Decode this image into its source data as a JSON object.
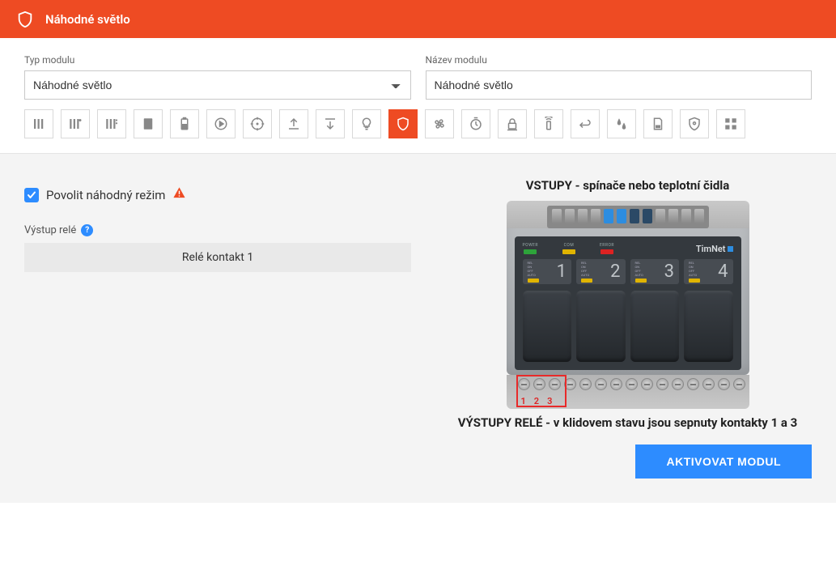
{
  "header": {
    "title": "Náhodné světlo"
  },
  "fields": {
    "type_label": "Typ modulu",
    "type_value": "Náhodné světlo",
    "name_label": "Název modulu",
    "name_value": "Náhodné světlo"
  },
  "icons": [
    "bars1",
    "bars2",
    "bars3",
    "panel",
    "battery",
    "play",
    "target",
    "upload",
    "download",
    "bulb",
    "shield",
    "fan",
    "clock",
    "lock",
    "remote",
    "switch",
    "drops",
    "doc",
    "shield2",
    "grid"
  ],
  "active_icon": "shield",
  "random": {
    "checkbox_label": "Povolit náhodný režim",
    "output_label": "Výstup relé",
    "relay_value": "Relé kontakt 1"
  },
  "device": {
    "inputs_title": "VSTUPY - spínače nebo teplotní čidla",
    "outputs_title": "VÝSTUPY RELÉ - v klidovem stavu jsou sepnuty kontakty 1 a 3",
    "brand": "TimNet",
    "leds": [
      {
        "label": "POWER",
        "color": "green"
      },
      {
        "label": "COM",
        "color": "yellow"
      },
      {
        "label": "ERROR",
        "color": "red"
      }
    ],
    "channels": [
      "1",
      "2",
      "3",
      "4"
    ],
    "highlight": [
      "1",
      "2",
      "3"
    ]
  },
  "activate_label": "AKTIVOVAT MODUL"
}
